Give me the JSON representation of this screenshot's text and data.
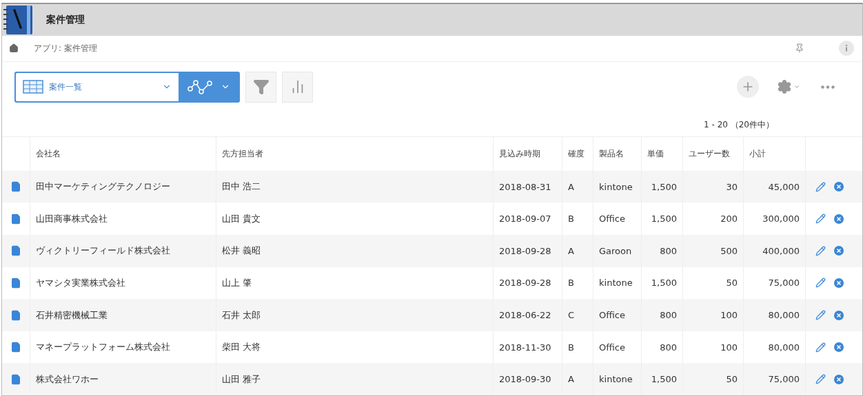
{
  "app_header": {
    "title": "案件管理"
  },
  "breadcrumb": {
    "path": "アプリ: 案件管理"
  },
  "toolbar": {
    "view_selector": {
      "value": "案件一覧"
    }
  },
  "record_count": "1 - 20 （20件中）",
  "table": {
    "columns": [
      "会社名",
      "先方担当者",
      "見込み時期",
      "確度",
      "製品名",
      "単価",
      "ユーザー数",
      "小計"
    ],
    "rows": [
      {
        "cells": [
          "田中マーケティングテクノロジー",
          "田中 浩二",
          "2018-08-31",
          "A",
          "kintone",
          "1,500",
          "30",
          "45,000"
        ]
      },
      {
        "cells": [
          "山田商事株式会社",
          "山田 貴文",
          "2018-09-07",
          "B",
          "Office",
          "1,500",
          "200",
          "300,000"
        ]
      },
      {
        "cells": [
          "ヴィクトリーフィールド株式会社",
          "松井 義昭",
          "2018-09-28",
          "A",
          "Garoon",
          "800",
          "500",
          "400,000"
        ]
      },
      {
        "cells": [
          "ヤマシタ実業株式会社",
          "山上 肇",
          "2018-09-28",
          "B",
          "kintone",
          "1,500",
          "50",
          "75,000"
        ]
      },
      {
        "cells": [
          "石井精密機械工業",
          "石井 太郎",
          "2018-06-22",
          "C",
          "Office",
          "800",
          "100",
          "80,000"
        ]
      },
      {
        "cells": [
          "マネープラットフォーム株式会社",
          "柴田 大将",
          "2018-11-30",
          "B",
          "Office",
          "800",
          "100",
          "80,000"
        ]
      },
      {
        "cells": [
          "株式会社ワホー",
          "山田 雅子",
          "2018-09-30",
          "A",
          "kintone",
          "1,500",
          "50",
          "75,000"
        ]
      }
    ]
  }
}
